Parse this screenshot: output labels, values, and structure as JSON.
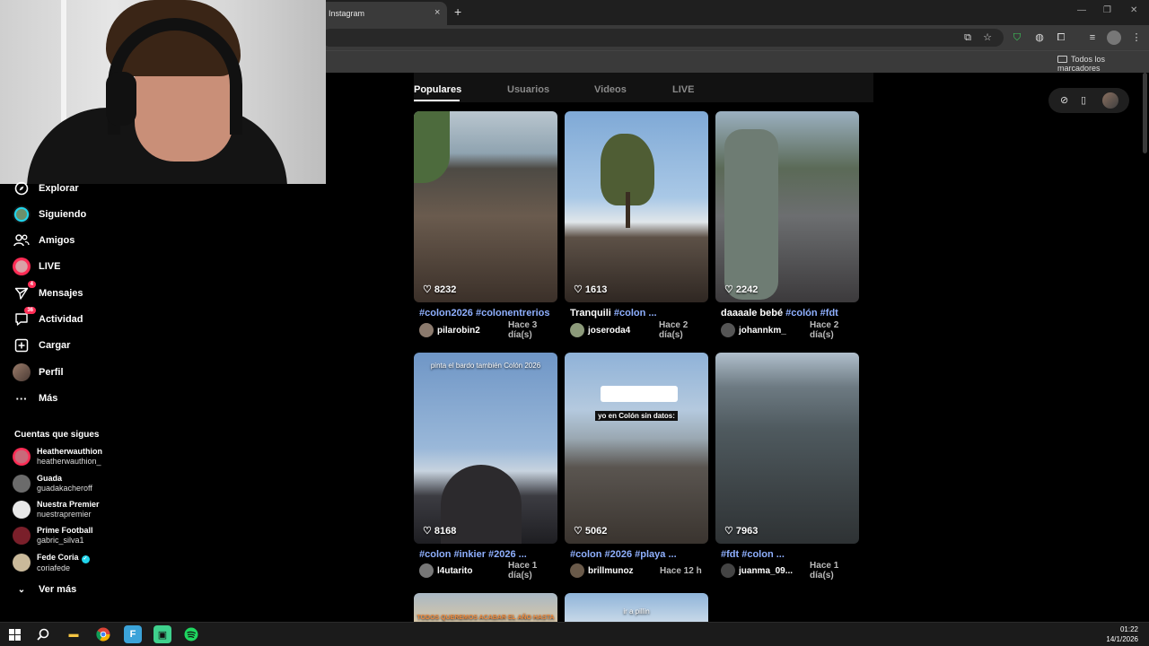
{
  "browser": {
    "tab_title": "Instagram",
    "tab_close": "×",
    "new_tab": "+",
    "bookmarks_folder": "Todos los marcadores"
  },
  "sidebar": {
    "items": [
      {
        "label": "Explorar",
        "icon": "compass-icon"
      },
      {
        "label": "Siguiendo",
        "icon": "following-avatar"
      },
      {
        "label": "Amigos",
        "icon": "friends-icon"
      },
      {
        "label": "LIVE",
        "icon": "live-avatar"
      },
      {
        "label": "Mensajes",
        "icon": "messages-icon",
        "badge": "4"
      },
      {
        "label": "Actividad",
        "icon": "activity-icon",
        "badge": "36"
      },
      {
        "label": "Cargar",
        "icon": "upload-icon"
      },
      {
        "label": "Perfil",
        "icon": "profile-avatar"
      },
      {
        "label": "Más",
        "icon": "more-icon"
      }
    ],
    "following_title": "Cuentas que sigues",
    "following": [
      {
        "name": "Heatherwauthion",
        "handle": "heatherwauthion_",
        "color": "#c86a7a"
      },
      {
        "name": "Guada",
        "handle": "guadakacheroff",
        "color": "#6b6b6b"
      },
      {
        "name": "Nuestra Premier",
        "handle": "nuestrapremier",
        "color": "#e8e8e8"
      },
      {
        "name": "Prime Football",
        "handle": "gabric_silva1",
        "color": "#7a1f2a"
      },
      {
        "name": "Fede Coria",
        "handle": "coriafede",
        "color": "#c9b99a",
        "verified": true
      }
    ],
    "see_more": "Ver más"
  },
  "search_tabs": {
    "populares": "Populares",
    "usuarios": "Usuarios",
    "videos": "Videos",
    "live": "LIVE"
  },
  "videos": [
    {
      "likes": "8232",
      "caption_tags": "#colon2026 #colonentrerios",
      "caption_text": "",
      "user": "pilarobin2",
      "time": "Hace 3 día(s)"
    },
    {
      "likes": "1613",
      "caption_text": "Tranquili ",
      "caption_tags": "#colon ...",
      "user": "joseroda4",
      "time": "Hace 2 día(s)"
    },
    {
      "likes": "2242",
      "caption_text": "daaaale bebé ",
      "caption_tags": "#colón #fdt",
      "user": "johannkm_",
      "time": "Hace 2 día(s)"
    },
    {
      "likes": "8168",
      "caption_tags": "#colon #inkier #2026 ...",
      "caption_text": "",
      "user": "l4utarito",
      "time": "Hace 1 día(s)",
      "overlay": "pinta el bardo también Colón 2026"
    },
    {
      "likes": "5062",
      "caption_tags": "#colon #2026 #playa ...",
      "caption_text": "",
      "user": "brillmunoz",
      "time": "Hace 12 h",
      "overlay": "yo en Colón sin datos:"
    },
    {
      "likes": "7963",
      "caption_tags": "#fdt #colon ...",
      "caption_text": "",
      "user": "juanma_09...",
      "time": "Hace 1 día(s)"
    }
  ],
  "partial_videos": [
    {
      "overlay": "TODOS QUEREMOS ACABAR EL AÑO HASTA"
    },
    {
      "overlay": "ir a pillin"
    }
  ],
  "taskbar": {
    "time": "01:22",
    "date": "14/1/2026"
  }
}
